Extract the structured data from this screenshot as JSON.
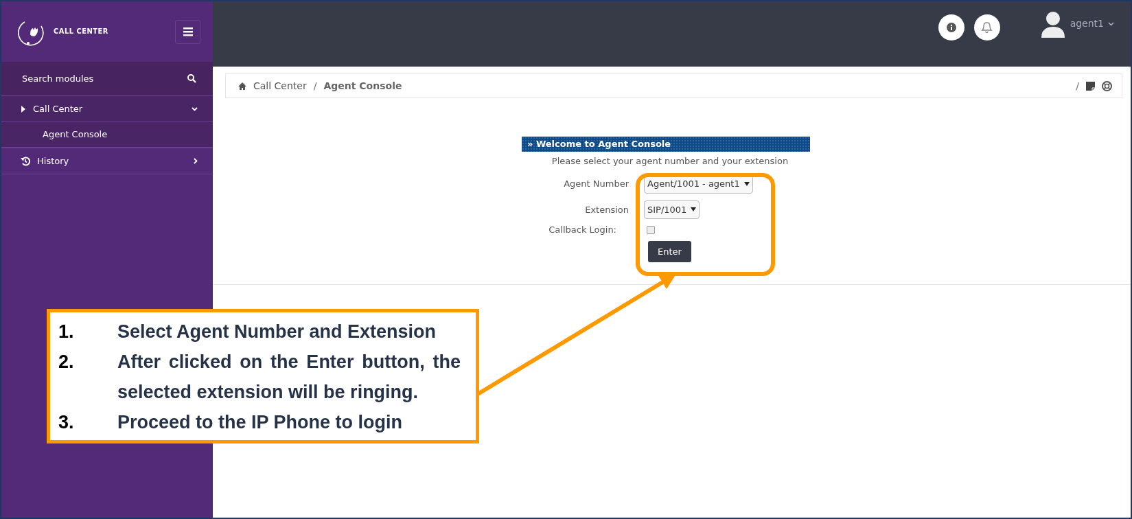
{
  "sidebar": {
    "logo_text": "CALL CENTER",
    "search_placeholder": "Search modules",
    "items": [
      {
        "kind": "module",
        "label": "Call Center",
        "expanded": true,
        "children": [
          {
            "label": "Agent Console",
            "selected": true
          }
        ]
      },
      {
        "kind": "history",
        "label": "History",
        "expanded": false
      }
    ]
  },
  "topbar": {
    "user": "agent1"
  },
  "breadcrumb": {
    "items": [
      "Call Center",
      "Agent Console"
    ],
    "separator": "/",
    "right_separator": "/"
  },
  "panel": {
    "title": "» Welcome to Agent Console",
    "subtitle": "Please select your agent number and your extension",
    "fields": [
      {
        "kind": "select",
        "label": "Agent Number",
        "value": "Agent/1001 - agent1"
      },
      {
        "kind": "select",
        "label": "Extension",
        "value": "SIP/1001"
      },
      {
        "kind": "checkbox",
        "label": "Callback Login:",
        "checked": false
      }
    ],
    "button": "Enter"
  },
  "callout": {
    "steps": [
      {
        "number": "1.",
        "text": "Select Agent Number and Extension"
      },
      {
        "number": "2.",
        "text": "After clicked on the Enter button, the selected extension will be ringing."
      },
      {
        "number": "3.",
        "text": "Proceed to the IP Phone to login"
      }
    ]
  }
}
